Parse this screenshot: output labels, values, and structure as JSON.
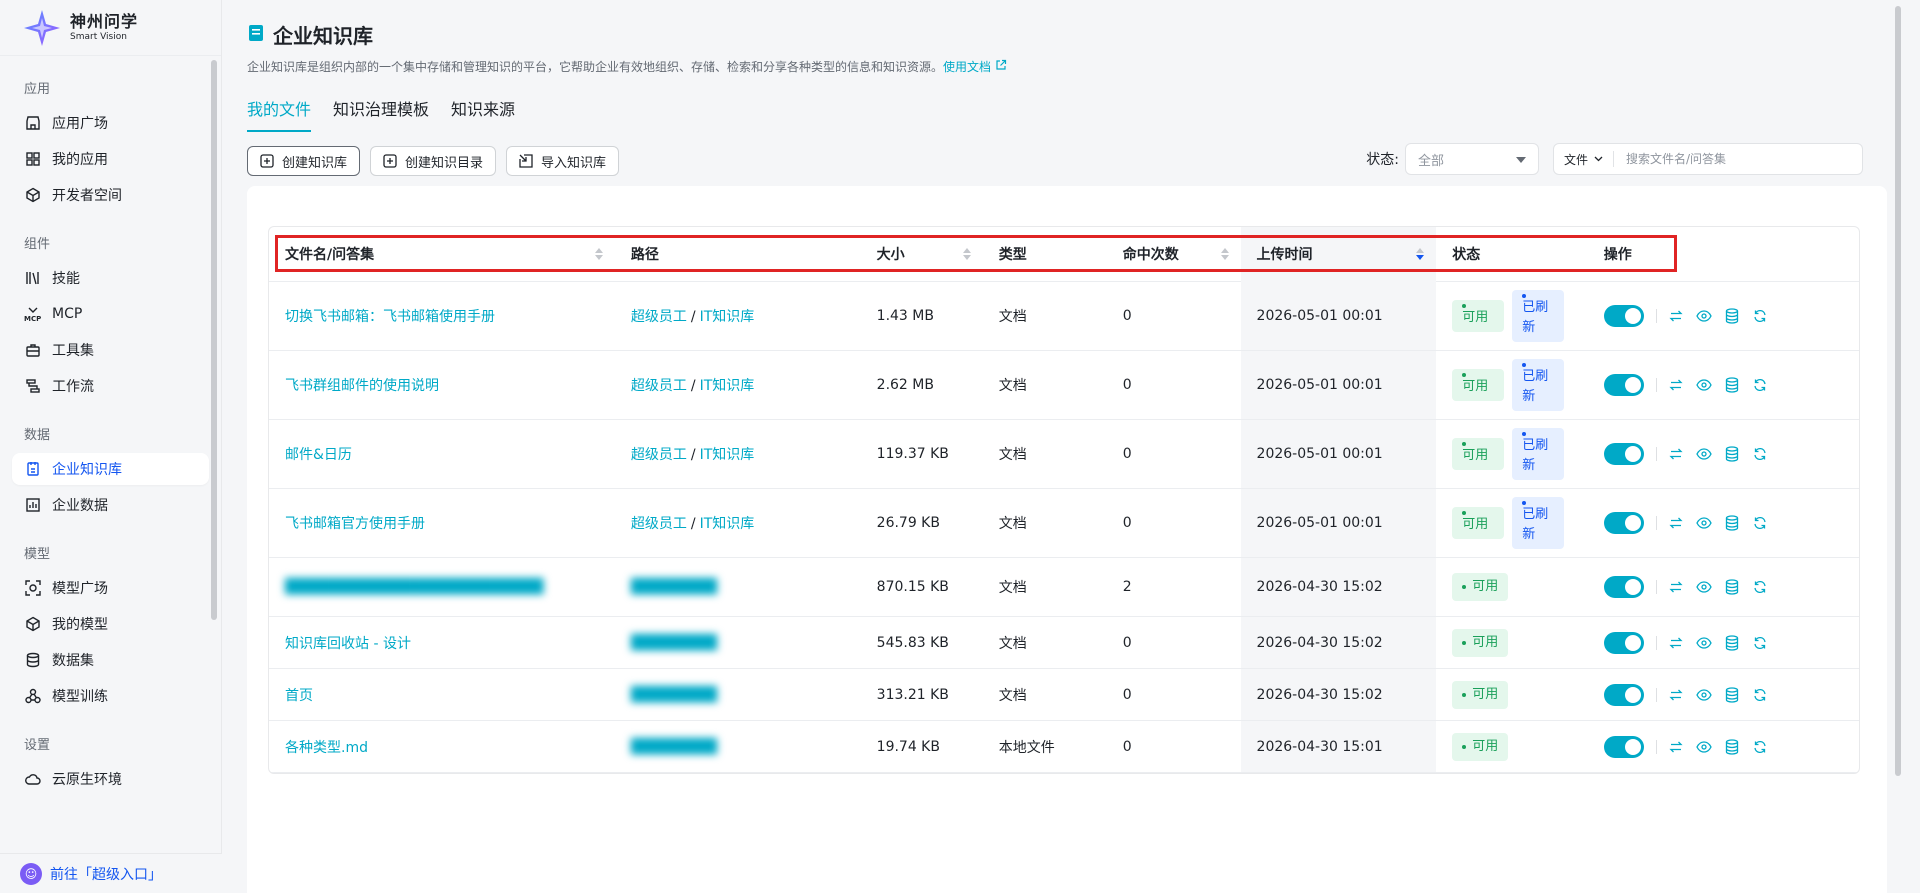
{
  "brand": {
    "name_cn": "神州问学",
    "name_en": "Smart Vision"
  },
  "sidebar": {
    "groups": [
      {
        "title": "应用",
        "items": [
          {
            "label": "应用广场",
            "icon": "shop-icon"
          },
          {
            "label": "我的应用",
            "icon": "grid-icon"
          },
          {
            "label": "开发者空间",
            "icon": "cube-icon"
          }
        ]
      },
      {
        "title": "组件",
        "items": [
          {
            "label": "技能",
            "icon": "books-icon"
          },
          {
            "label": "MCP",
            "icon": "mcp-icon"
          },
          {
            "label": "工具集",
            "icon": "toolbox-icon"
          },
          {
            "label": "工作流",
            "icon": "workflow-icon"
          }
        ]
      },
      {
        "title": "数据",
        "items": [
          {
            "label": "企业知识库",
            "icon": "knowledge-icon",
            "active": true
          },
          {
            "label": "企业数据",
            "icon": "chart-icon"
          }
        ]
      },
      {
        "title": "模型",
        "items": [
          {
            "label": "模型广场",
            "icon": "model-square-icon"
          },
          {
            "label": "我的模型",
            "icon": "box-icon"
          },
          {
            "label": "数据集",
            "icon": "database-icon"
          },
          {
            "label": "模型训练",
            "icon": "training-icon"
          }
        ]
      },
      {
        "title": "设置",
        "items": [
          {
            "label": "云原生环境",
            "icon": "cloud-icon"
          }
        ]
      }
    ],
    "footer": "前往「超级入口」"
  },
  "page": {
    "title": "企业知识库",
    "desc": "企业知识库是组织内部的一个集中存储和管理知识的平台，它帮助企业有效地组织、存储、检索和分享各种类型的信息和知识资源。",
    "doc_link": "使用文档",
    "tabs": [
      "我的文件",
      "知识治理模板",
      "知识来源"
    ],
    "buttons": {
      "create_kb": "创建知识库",
      "create_dir": "创建知识目录",
      "import_kb": "导入知识库"
    },
    "filter": {
      "status_label": "状态:",
      "status_value": "全部",
      "search_type": "文件",
      "search_placeholder": "搜索文件名/问答集"
    }
  },
  "table": {
    "headers": {
      "name": "文件名/问答集",
      "path": "路径",
      "size": "大小",
      "type": "类型",
      "hits": "命中次数",
      "time": "上传时间",
      "status": "状态",
      "ops": "操作"
    },
    "rows": [
      {
        "name": "切换飞书邮箱：飞书邮箱使用手册",
        "path_a": "超级员工",
        "path_b": "IT知识库",
        "size": "1.43 MB",
        "type": "文档",
        "hits": "0",
        "time": "2026-05-01 00:01",
        "status": [
          "可用",
          "已刷新"
        ]
      },
      {
        "name": "飞书群组邮件的使用说明",
        "path_a": "超级员工",
        "path_b": "IT知识库",
        "size": "2.62 MB",
        "type": "文档",
        "hits": "0",
        "time": "2026-05-01 00:01",
        "status": [
          "可用",
          "已刷新"
        ]
      },
      {
        "name": "邮件&日历",
        "path_a": "超级员工",
        "path_b": "IT知识库",
        "size": "119.37 KB",
        "type": "文档",
        "hits": "0",
        "time": "2026-05-01 00:01",
        "status": [
          "可用",
          "已刷新"
        ]
      },
      {
        "name": "飞书邮箱官方使用手册",
        "path_a": "超级员工",
        "path_b": "IT知识库",
        "size": "26.79 KB",
        "type": "文档",
        "hits": "0",
        "time": "2026-05-01 00:01",
        "status": [
          "可用",
          "已刷新"
        ]
      },
      {
        "name": "",
        "path_a": "",
        "path_b": "",
        "size": "870.15 KB",
        "type": "文档",
        "hits": "2",
        "time": "2026-04-30 15:02",
        "status": [
          "可用"
        ],
        "blurred": true
      },
      {
        "name": "知识库回收站 - 设计",
        "path_a": "",
        "path_b": "",
        "size": "545.83 KB",
        "type": "文档",
        "hits": "0",
        "time": "2026-04-30 15:02",
        "status": [
          "可用"
        ],
        "blurred_path": true
      },
      {
        "name": "首页",
        "path_a": "",
        "path_b": "",
        "size": "313.21 KB",
        "type": "文档",
        "hits": "0",
        "time": "2026-04-30 15:02",
        "status": [
          "可用"
        ],
        "blurred_path": true
      },
      {
        "name": "各种类型.md",
        "path_a": "",
        "path_b": "",
        "size": "19.74 KB",
        "type": "本地文件",
        "hits": "0",
        "time": "2026-04-30 15:01",
        "status": [
          "可用"
        ],
        "blurred_path": true
      }
    ]
  },
  "colors": {
    "accent": "#00a9c7",
    "primary": "#1456f0",
    "ok_bg": "#e4f7ec",
    "ok_text": "#1aa05a",
    "highlight_border": "#e02424"
  }
}
